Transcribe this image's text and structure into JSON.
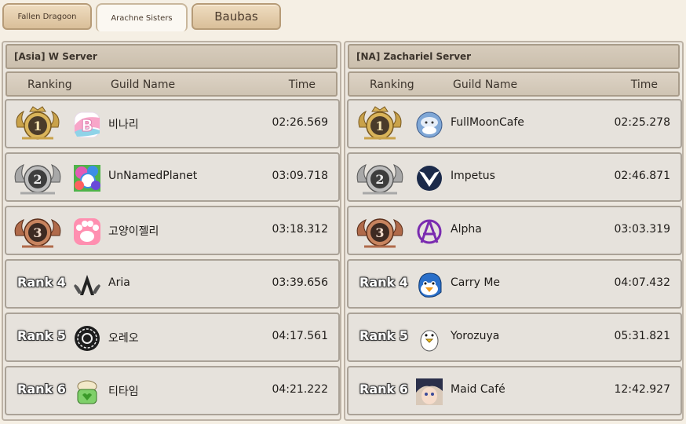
{
  "tabs": [
    {
      "label": "Fallen Dragoon",
      "active": false
    },
    {
      "label": "Arachne Sisters",
      "active": true
    },
    {
      "label": "Baubas",
      "active": false
    }
  ],
  "headers": {
    "ranking": "Ranking",
    "guild": "Guild Name",
    "time": "Time"
  },
  "panels": [
    {
      "server": "[Asia] W Server",
      "rows": [
        {
          "rank": "1",
          "guild": "비나리",
          "time": "02:26.569"
        },
        {
          "rank": "2",
          "guild": "UnNamedPlanet",
          "time": "03:09.718"
        },
        {
          "rank": "3",
          "guild": "고양이젤리",
          "time": "03:18.312"
        },
        {
          "rank": "Rank 4",
          "guild": "Aria",
          "time": "03:39.656"
        },
        {
          "rank": "Rank 5",
          "guild": "오레오",
          "time": "04:17.561"
        },
        {
          "rank": "Rank 6",
          "guild": "티타임",
          "time": "04:21.222"
        }
      ]
    },
    {
      "server": "[NA] Zachariel Server",
      "rows": [
        {
          "rank": "1",
          "guild": "FullMoonCafe",
          "time": "02:25.278"
        },
        {
          "rank": "2",
          "guild": "Impetus",
          "time": "02:46.871"
        },
        {
          "rank": "3",
          "guild": "Alpha",
          "time": "03:03.319"
        },
        {
          "rank": "Rank 4",
          "guild": "Carry Me",
          "time": "04:07.432"
        },
        {
          "rank": "Rank 5",
          "guild": "Yorozuya",
          "time": "05:31.821"
        },
        {
          "rank": "Rank 6",
          "guild": "Maid Café",
          "time": "12:42.927"
        }
      ]
    }
  ],
  "colors": {
    "gold": "#c9a24a",
    "silver": "#9a9a9a",
    "bronze": "#b06a4a",
    "medal_core": "#3d3a37"
  }
}
